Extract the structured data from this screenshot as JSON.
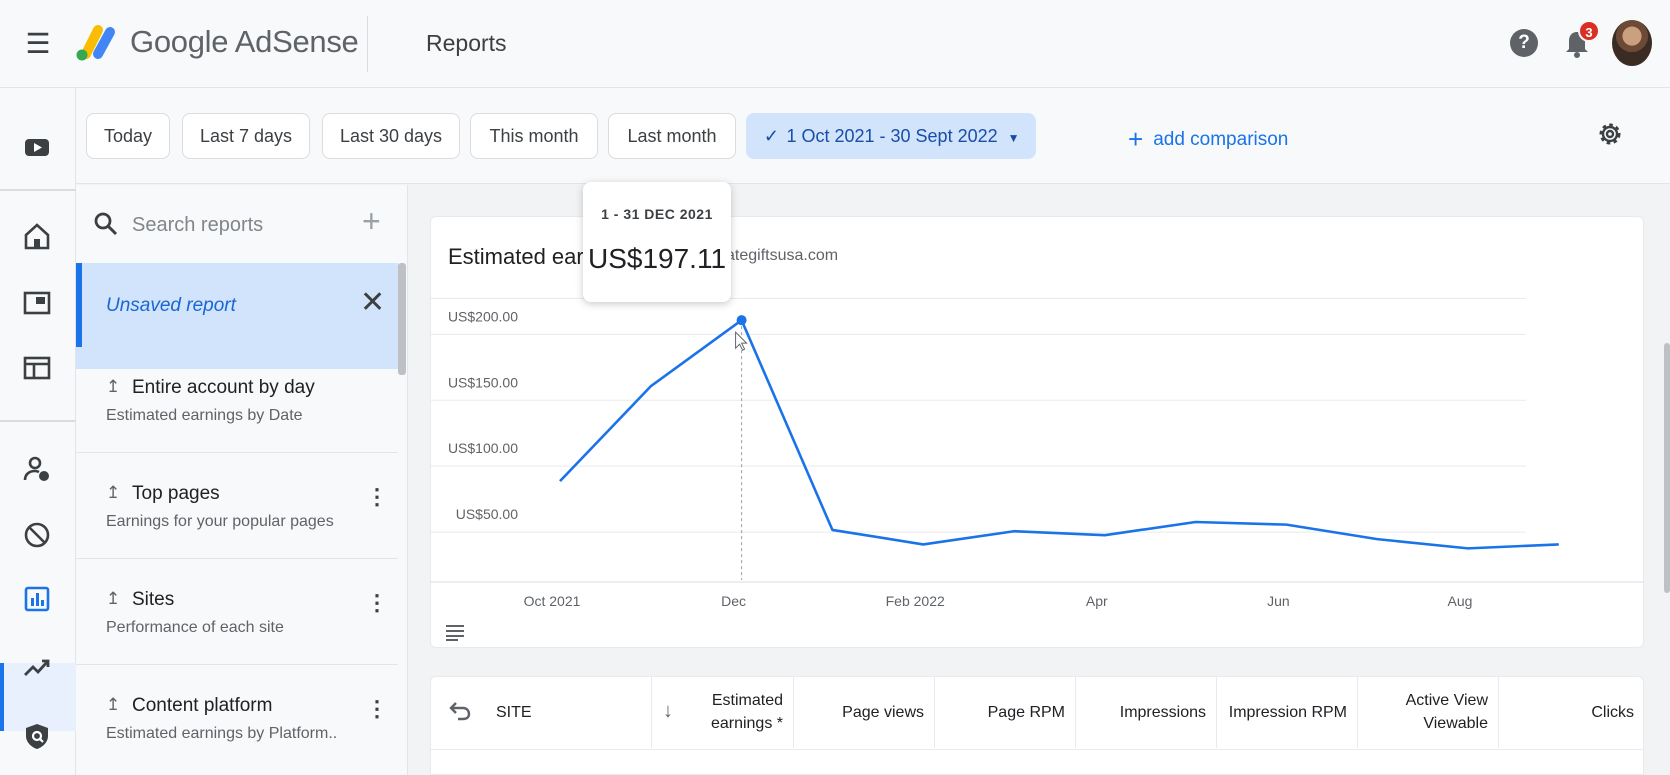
{
  "app": {
    "brand": "Google AdSense",
    "page_title": "Reports",
    "notification_count": "3"
  },
  "filters": {
    "chips": [
      "Today",
      "Last 7 days",
      "Last 30 days",
      "This month",
      "Last month"
    ],
    "selected_range": "1 Oct 2021 - 30 Sept 2022",
    "add_comparison": "add comparison"
  },
  "reports": {
    "search_placeholder": "Search reports",
    "unsaved": "Unsaved report",
    "items": [
      {
        "title": "Entire account by day",
        "subtitle": "Estimated earnings by Date"
      },
      {
        "title": "Top pages",
        "subtitle": "Earnings for your popular pages"
      },
      {
        "title": "Sites",
        "subtitle": "Performance of each site"
      },
      {
        "title": "Content platform",
        "subtitle": "Estimated earnings by Platform..."
      }
    ]
  },
  "chart": {
    "title": "Estimated ear",
    "site_fragment": "ategiftsusa.com",
    "tooltip": {
      "date": "1 - 31 DEC 2021",
      "value": "US$197.11"
    }
  },
  "chart_data": {
    "type": "line",
    "title": "Estimated ear",
    "x_ticks": [
      "Oct 2021",
      "Dec",
      "Feb 2022",
      "Apr",
      "Jun",
      "Aug"
    ],
    "y_ticks": [
      "US$50.00",
      "US$100.00",
      "US$150.00",
      "US$200.00"
    ],
    "ylim": [
      0,
      220
    ],
    "x": [
      "2021-10",
      "2021-11",
      "2021-12",
      "2022-01",
      "2022-02",
      "2022-03",
      "2022-04",
      "2022-05",
      "2022-06",
      "2022-07",
      "2022-08",
      "2022-09"
    ],
    "values": [
      75,
      147,
      197.11,
      38,
      27,
      37,
      34,
      44,
      42,
      31,
      24,
      27
    ],
    "color": "#1a73e8",
    "grid": true,
    "highlight_index": 2
  },
  "table": {
    "headers": {
      "site": "SITE",
      "earnings": "Estimated earnings *",
      "page_views": "Page views",
      "page_rpm": "Page RPM",
      "impressions": "Impressions",
      "impression_rpm": "Impression RPM",
      "active_view": "Active View Viewable",
      "clicks": "Clicks"
    }
  }
}
